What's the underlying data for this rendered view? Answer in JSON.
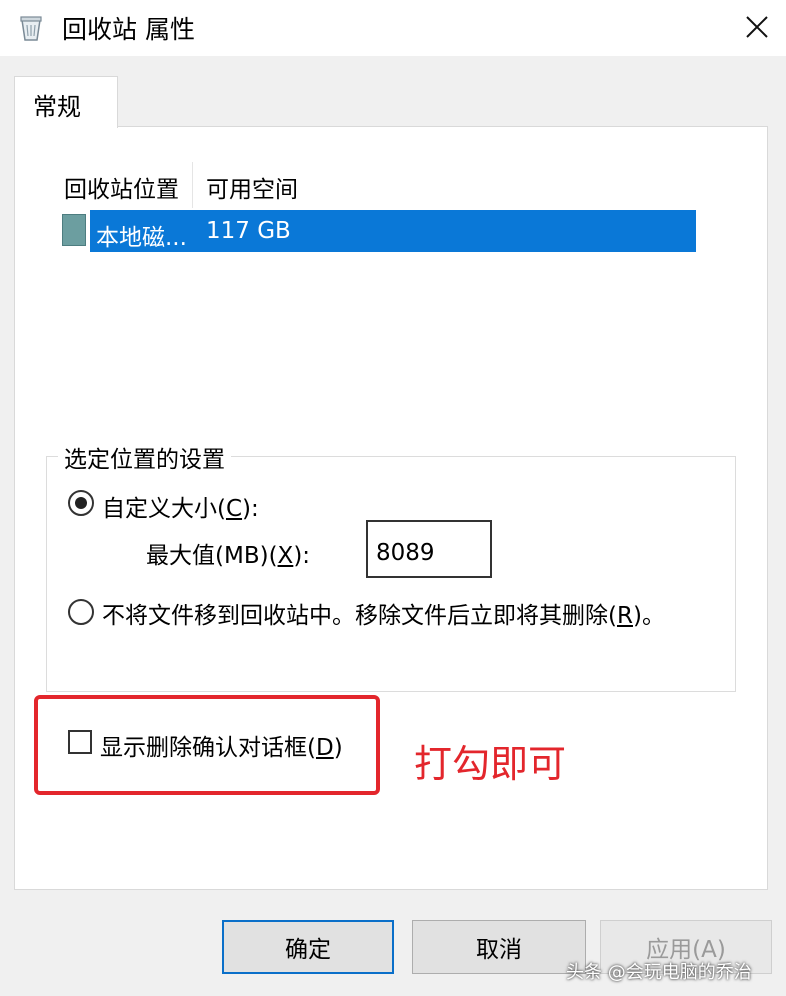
{
  "window": {
    "title": "回收站 属性",
    "icon": "recycle-bin-icon",
    "close_icon": "close-icon"
  },
  "tabs": [
    {
      "label": "常规",
      "selected": true
    }
  ],
  "locations_list": {
    "columns": [
      "回收站位置",
      "可用空间"
    ],
    "rows": [
      {
        "location": "本地磁...",
        "free_space": "117 GB",
        "icon": "drive-icon",
        "selected": true
      }
    ]
  },
  "settings_group": {
    "title": "选定位置的设置",
    "custom_size": {
      "label_text": "自定义大小(",
      "label_key": "C",
      "label_end": "):",
      "checked": true
    },
    "max_size": {
      "label_text": "最大值(MB)(",
      "label_key": "X",
      "label_end": "):",
      "value": "8089"
    },
    "no_recycle": {
      "label_text": "不将文件移到回收站中。移除文件后立即将其删除(",
      "label_key": "R",
      "label_end": ")。",
      "checked": false
    }
  },
  "confirm_delete": {
    "label_text": "显示删除确认对话框(",
    "label_key": "D",
    "label_end": ")",
    "checked": false
  },
  "annotation": {
    "text": "打勾即可",
    "color": "#e3262c"
  },
  "buttons": {
    "ok": "确定",
    "cancel": "取消",
    "apply": "应用(A)"
  },
  "watermark": "头条 @会玩电脑的乔治",
  "colors": {
    "selection": "#0a78d7",
    "annotation_red": "#e3262c",
    "default_button_border": "#0a6fc9"
  }
}
